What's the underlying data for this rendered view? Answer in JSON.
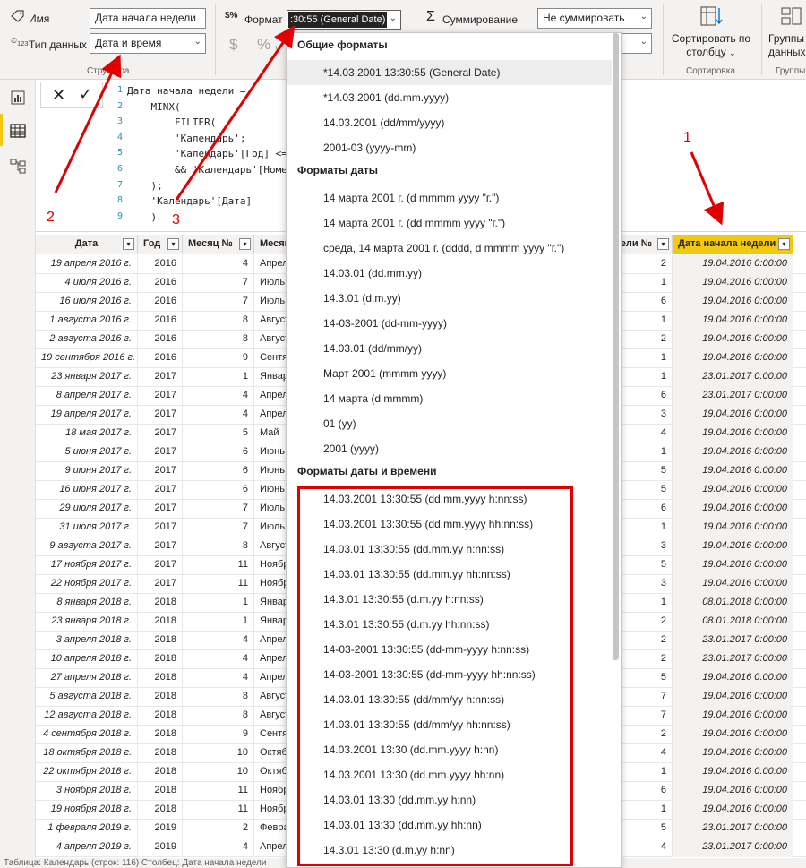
{
  "ribbon": {
    "name_label": "Имя",
    "name_value": "Дата начала недели",
    "datatype_label": "Тип данных",
    "datatype_value": "Дата и время",
    "structure_caption": "Структура",
    "format_label": "Формат",
    "format_value": ":30:55 (General Date)",
    "currency_symbol": "$",
    "percent_symbol": "%",
    "comma_symbol": ",",
    "decimals_symbol": ".00",
    "summation_label": "Суммирование",
    "summation_value": "Не суммировать",
    "sort_label_1": "Сортировать по",
    "sort_label_2": "столбцу",
    "sort_caption": "Сортировка",
    "groups_label_1": "Группы",
    "groups_label_2": "данных",
    "groups_caption": "Группы"
  },
  "formula": {
    "lines": [
      {
        "n": "1",
        "text": "Дата начала недели ="
      },
      {
        "n": "2",
        "text": "    MINX("
      },
      {
        "n": "3",
        "text": "        FILTER("
      },
      {
        "n": "4",
        "text": "        'Календарь';"
      },
      {
        "n": "5",
        "text": "        'Календарь'[Год] <="
      },
      {
        "n": "6",
        "text": "        && 'Календарь'[Номе"
      },
      {
        "n": "7",
        "text": "    );"
      },
      {
        "n": "8",
        "text": "    'Календарь'[Дата]"
      },
      {
        "n": "9",
        "text": "    )"
      }
    ]
  },
  "table": {
    "headers": {
      "date": "Дата",
      "year": "Год",
      "month_no": "Месяц №",
      "month": "Месяц",
      "week_no": "ели №",
      "week_start": "Дата начала недели"
    },
    "rows": [
      {
        "date": "19 апреля 2016 г.",
        "year": "2016",
        "mn": "4",
        "m": "Апрел",
        "w": "2",
        "ws": "19.04.2016 0:00:00"
      },
      {
        "date": "4 июля 2016 г.",
        "year": "2016",
        "mn": "7",
        "m": "Июль",
        "w": "1",
        "ws": "19.04.2016 0:00:00"
      },
      {
        "date": "16 июля 2016 г.",
        "year": "2016",
        "mn": "7",
        "m": "Июль",
        "w": "6",
        "ws": "19.04.2016 0:00:00"
      },
      {
        "date": "1 августа 2016 г.",
        "year": "2016",
        "mn": "8",
        "m": "Август",
        "w": "1",
        "ws": "19.04.2016 0:00:00"
      },
      {
        "date": "2 августа 2016 г.",
        "year": "2016",
        "mn": "8",
        "m": "Август",
        "w": "2",
        "ws": "19.04.2016 0:00:00"
      },
      {
        "date": "19 сентября 2016 г.",
        "year": "2016",
        "mn": "9",
        "m": "Сентя",
        "w": "1",
        "ws": "19.04.2016 0:00:00"
      },
      {
        "date": "23 января 2017 г.",
        "year": "2017",
        "mn": "1",
        "m": "Январ",
        "w": "1",
        "ws": "23.01.2017 0:00:00"
      },
      {
        "date": "8 апреля 2017 г.",
        "year": "2017",
        "mn": "4",
        "m": "Апрел",
        "w": "6",
        "ws": "23.01.2017 0:00:00"
      },
      {
        "date": "19 апреля 2017 г.",
        "year": "2017",
        "mn": "4",
        "m": "Апрел",
        "w": "3",
        "ws": "19.04.2016 0:00:00"
      },
      {
        "date": "18 мая 2017 г.",
        "year": "2017",
        "mn": "5",
        "m": "Май",
        "w": "4",
        "ws": "19.04.2016 0:00:00"
      },
      {
        "date": "5 июня 2017 г.",
        "year": "2017",
        "mn": "6",
        "m": "Июнь",
        "w": "1",
        "ws": "19.04.2016 0:00:00"
      },
      {
        "date": "9 июня 2017 г.",
        "year": "2017",
        "mn": "6",
        "m": "Июнь",
        "w": "5",
        "ws": "19.04.2016 0:00:00"
      },
      {
        "date": "16 июня 2017 г.",
        "year": "2017",
        "mn": "6",
        "m": "Июнь",
        "w": "5",
        "ws": "19.04.2016 0:00:00"
      },
      {
        "date": "29 июля 2017 г.",
        "year": "2017",
        "mn": "7",
        "m": "Июль",
        "w": "6",
        "ws": "19.04.2016 0:00:00"
      },
      {
        "date": "31 июля 2017 г.",
        "year": "2017",
        "mn": "7",
        "m": "Июль",
        "w": "1",
        "ws": "19.04.2016 0:00:00"
      },
      {
        "date": "9 августа 2017 г.",
        "year": "2017",
        "mn": "8",
        "m": "Август",
        "w": "3",
        "ws": "19.04.2016 0:00:00"
      },
      {
        "date": "17 ноября 2017 г.",
        "year": "2017",
        "mn": "11",
        "m": "Ноябр",
        "w": "5",
        "ws": "19.04.2016 0:00:00"
      },
      {
        "date": "22 ноября 2017 г.",
        "year": "2017",
        "mn": "11",
        "m": "Ноябр",
        "w": "3",
        "ws": "19.04.2016 0:00:00"
      },
      {
        "date": "8 января 2018 г.",
        "year": "2018",
        "mn": "1",
        "m": "Январ",
        "w": "1",
        "ws": "08.01.2018 0:00:00"
      },
      {
        "date": "23 января 2018 г.",
        "year": "2018",
        "mn": "1",
        "m": "Январ",
        "w": "2",
        "ws": "08.01.2018 0:00:00"
      },
      {
        "date": "3 апреля 2018 г.",
        "year": "2018",
        "mn": "4",
        "m": "Апрел",
        "w": "2",
        "ws": "23.01.2017 0:00:00"
      },
      {
        "date": "10 апреля 2018 г.",
        "year": "2018",
        "mn": "4",
        "m": "Апрел",
        "w": "2",
        "ws": "23.01.2017 0:00:00"
      },
      {
        "date": "27 апреля 2018 г.",
        "year": "2018",
        "mn": "4",
        "m": "Апрел",
        "w": "5",
        "ws": "19.04.2016 0:00:00"
      },
      {
        "date": "5 августа 2018 г.",
        "year": "2018",
        "mn": "8",
        "m": "Август",
        "w": "7",
        "ws": "19.04.2016 0:00:00"
      },
      {
        "date": "12 августа 2018 г.",
        "year": "2018",
        "mn": "8",
        "m": "Август",
        "w": "7",
        "ws": "19.04.2016 0:00:00"
      },
      {
        "date": "4 сентября 2018 г.",
        "year": "2018",
        "mn": "9",
        "m": "Сентя",
        "w": "2",
        "ws": "19.04.2016 0:00:00"
      },
      {
        "date": "18 октября 2018 г.",
        "year": "2018",
        "mn": "10",
        "m": "Октяб",
        "w": "4",
        "ws": "19.04.2016 0:00:00"
      },
      {
        "date": "22 октября 2018 г.",
        "year": "2018",
        "mn": "10",
        "m": "Октяб",
        "w": "1",
        "ws": "19.04.2016 0:00:00"
      },
      {
        "date": "3 ноября 2018 г.",
        "year": "2018",
        "mn": "11",
        "m": "Ноябр",
        "w": "6",
        "ws": "19.04.2016 0:00:00"
      },
      {
        "date": "19 ноября 2018 г.",
        "year": "2018",
        "mn": "11",
        "m": "Ноябр",
        "w": "1",
        "ws": "19.04.2016 0:00:00"
      },
      {
        "date": "1 февраля 2019 г.",
        "year": "2019",
        "mn": "2",
        "m": "Февра",
        "w": "5",
        "ws": "23.01.2017 0:00:00"
      },
      {
        "date": "4 апреля 2019 г.",
        "year": "2019",
        "mn": "4",
        "m": "Апрел",
        "w": "4",
        "ws": "23.01.2017 0:00:00"
      }
    ]
  },
  "dropdown": {
    "sections": [
      {
        "title": "Общие форматы",
        "items": [
          "*14.03.2001 13:30:55 (General Date)",
          "*14.03.2001 (dd.mm.yyyy)",
          "14.03.2001 (dd/mm/yyyy)",
          "2001-03 (yyyy-mm)"
        ]
      },
      {
        "title": "Форматы даты",
        "items": [
          "14 марта 2001 г. (d mmmm yyyy \"г.\")",
          "14 марта 2001 г. (dd mmmm yyyy \"г.\")",
          "среда, 14 марта 2001 г. (dddd, d mmmm yyyy \"г.\")",
          "14.03.01 (dd.mm.yy)",
          "14.3.01 (d.m.yy)",
          "14-03-2001 (dd-mm-yyyy)",
          "14.03.01 (dd/mm/yy)",
          "Март 2001 (mmmm yyyy)",
          "14 марта (d mmmm)",
          "01 (yy)",
          "2001 (yyyy)"
        ]
      },
      {
        "title": "Форматы даты и времени",
        "items": [
          "14.03.2001 13:30:55 (dd.mm.yyyy h:nn:ss)",
          "14.03.2001 13:30:55 (dd.mm.yyyy hh:nn:ss)",
          "14.03.01 13:30:55 (dd.mm.yy h:nn:ss)",
          "14.03.01 13:30:55 (dd.mm.yy hh:nn:ss)",
          "14.3.01 13:30:55 (d.m.yy h:nn:ss)",
          "14.3.01 13:30:55 (d.m.yy hh:nn:ss)",
          "14-03-2001 13:30:55 (dd-mm-yyyy h:nn:ss)",
          "14-03-2001 13:30:55 (dd-mm-yyyy hh:nn:ss)",
          "14.03.01 13:30:55 (dd/mm/yy h:nn:ss)",
          "14.03.01 13:30:55 (dd/mm/yy hh:nn:ss)",
          "14.03.2001 13:30 (dd.mm.yyyy h:nn)",
          "14.03.2001 13:30 (dd.mm.yyyy hh:nn)",
          "14.03.01 13:30 (dd.mm.yy h:nn)",
          "14.03.01 13:30 (dd.mm.yy hh:nn)",
          "14.3.01 13:30 (d.m.yy h:nn)"
        ]
      }
    ]
  },
  "annotations": {
    "label1": "1",
    "label2": "2",
    "label3": "3"
  },
  "status": {
    "text": "Таблица: Календарь (строк: 116) Столбец: Дата начала недели"
  },
  "colors": {
    "accent_yellow": "#f2c811",
    "annotation_red": "#e00000"
  }
}
